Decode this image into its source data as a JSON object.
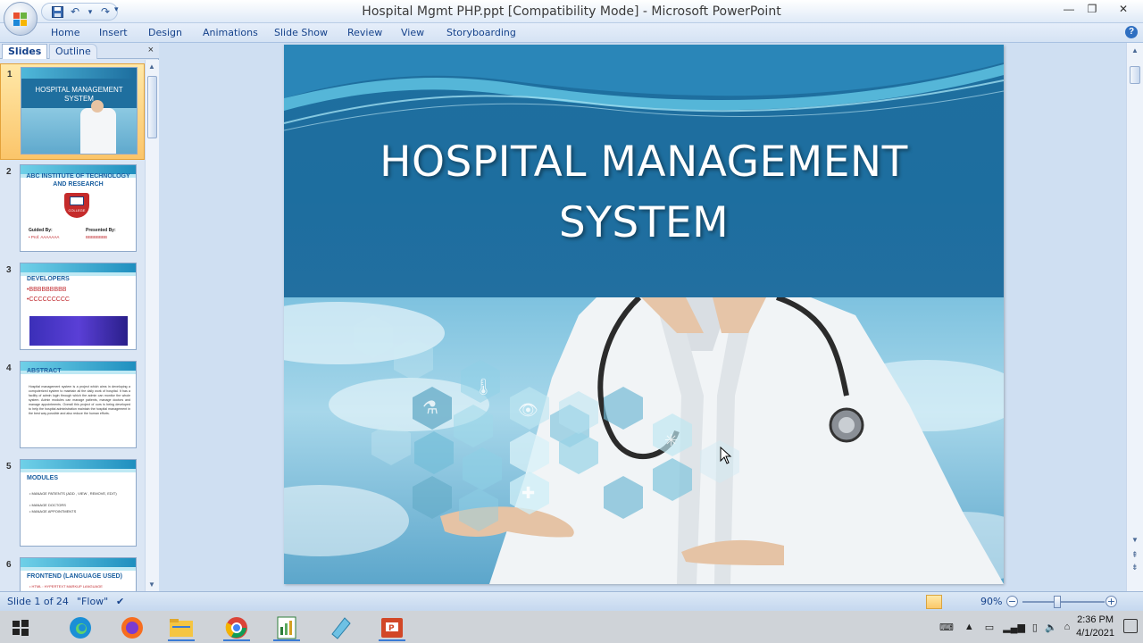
{
  "window": {
    "title": "Hospital Mgmt PHP.ppt [Compatibility Mode] - Microsoft PowerPoint",
    "minimize": "—",
    "maximize": "❐",
    "close": "✕"
  },
  "qat": {
    "save": "save-icon",
    "undo": "↶",
    "redo": "↷",
    "customize": "▾"
  },
  "ribbon_tabs": [
    "Home",
    "Insert",
    "Design",
    "Animations",
    "Slide Show",
    "Review",
    "View",
    "Storyboarding"
  ],
  "help": "?",
  "panel": {
    "slides_tab": "Slides",
    "outline_tab": "Outline",
    "close": "×"
  },
  "thumbnails": [
    {
      "num": "1",
      "title": "HOSPITAL MANAGEMENT SYSTEM"
    },
    {
      "num": "2",
      "title": "ABC INSTITUTE OF TECHNOLOGY AND RESEARCH",
      "guided": "Guided By:",
      "guided_name": "• Prof. AAAAAAA",
      "presented": "Presented By:",
      "presented_name": "BBBBBBBB",
      "logo": "COLLEGE"
    },
    {
      "num": "3",
      "title": "DEVELOPERS",
      "line1": "•BBBBBBBBB",
      "line2": "•CCCCCCCCC"
    },
    {
      "num": "4",
      "title": "ABSTRACT",
      "body": "Hospital management system is a project which aims in developing a computerized system to maintain all the daily work of hospital. It has a facility of admin login through which the admin can monitor the whole system. Admin modules can manage patients, manage doctors and manage appointments. Overall this project of ours is being developed to help the hospital administration maintain the hospital management in the best way possible and also reduce the human efforts."
    },
    {
      "num": "5",
      "title": "MODULES",
      "item1": "• MANAGE PATIENTS (ADD , VIEW , REMOVE, EDIT)",
      "item2": "• MANAGE DOCTORS",
      "item3": "• MANAGE APPOINTMENTS"
    },
    {
      "num": "6",
      "title": "FRONTEND (LANGUAGE USED)",
      "item1": "• HTML : HYPERTEXT MARKUP LANGUAGE"
    }
  ],
  "slide": {
    "title_line1": "HOSPITAL MANAGEMENT",
    "title_line2": "SYSTEM"
  },
  "status": {
    "slide_info": "Slide 1 of 24",
    "theme": "\"Flow\"",
    "zoom": "90%",
    "zoom_minus": "−",
    "zoom_plus": "+"
  },
  "taskbar": {
    "apps": [
      "start-icon",
      "edge-icon",
      "firefox-icon",
      "file-explorer-icon",
      "chrome-icon",
      "spreadsheet-icon",
      "notes-icon",
      "powerpoint-icon"
    ],
    "time": "2:36 PM",
    "date": "4/1/2021"
  },
  "colors": {
    "accent": "#15428b",
    "slide_blue": "#1f6f9f",
    "selected": "#fbc56a"
  }
}
